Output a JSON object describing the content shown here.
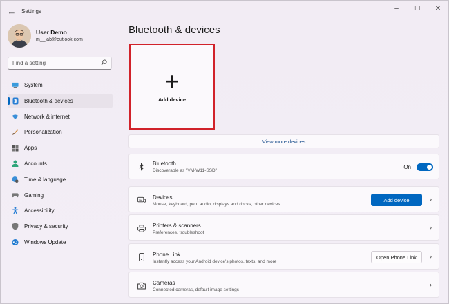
{
  "window": {
    "title": "Settings",
    "back_glyph": "←",
    "minimize_glyph": "–",
    "maximize_glyph": "☐",
    "close_glyph": "✕"
  },
  "user": {
    "name": "User Demo",
    "email": "m__lab@outlook.com"
  },
  "search": {
    "placeholder": "Find a setting"
  },
  "nav": {
    "items": [
      {
        "label": "System",
        "icon": "monitor-icon"
      },
      {
        "label": "Bluetooth & devices",
        "icon": "bluetooth-icon",
        "active": true
      },
      {
        "label": "Network & internet",
        "icon": "wifi-icon"
      },
      {
        "label": "Personalization",
        "icon": "brush-icon"
      },
      {
        "label": "Apps",
        "icon": "apps-icon"
      },
      {
        "label": "Accounts",
        "icon": "person-icon"
      },
      {
        "label": "Time & language",
        "icon": "globe-clock-icon"
      },
      {
        "label": "Gaming",
        "icon": "gamepad-icon"
      },
      {
        "label": "Accessibility",
        "icon": "accessibility-icon"
      },
      {
        "label": "Privacy & security",
        "icon": "shield-icon"
      },
      {
        "label": "Windows Update",
        "icon": "update-icon"
      }
    ]
  },
  "main": {
    "title": "Bluetooth & devices",
    "add_tile": {
      "label": "Add device",
      "glyph": "+"
    },
    "view_more": "View more devices",
    "bluetooth": {
      "title": "Bluetooth",
      "subtitle": "Discoverable as \"VM-W11-SSD\"",
      "state_label": "On",
      "enabled": true
    },
    "rows": [
      {
        "title": "Devices",
        "subtitle": "Mouse, keyboard, pen, audio, displays and docks, other devices",
        "button": "Add device"
      },
      {
        "title": "Printers & scanners",
        "subtitle": "Preferences, troubleshoot"
      },
      {
        "title": "Phone Link",
        "subtitle": "Instantly access your Android device's photos, texts, and more",
        "button": "Open Phone Link"
      },
      {
        "title": "Cameras",
        "subtitle": "Connected cameras, default image settings"
      }
    ],
    "chevron_glyph": "›"
  },
  "colors": {
    "accent": "#0067c0",
    "highlight_border": "#d1222a"
  }
}
